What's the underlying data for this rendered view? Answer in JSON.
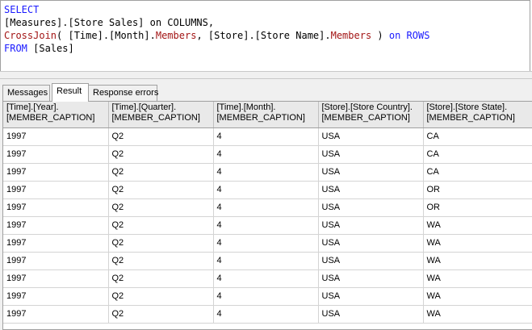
{
  "query": {
    "line1": "SELECT",
    "line2": "[Measures].[Store Sales] on COLUMNS,",
    "line3_fn": "CrossJoin",
    "line3_a": "( [Time].[Month].",
    "line3_members1": "Members",
    "line3_b": ", [Store].[Store Name].",
    "line3_members2": "Members",
    "line3_c": " ) ",
    "line3_kw": "on ROWS",
    "line4_kw": "FROM",
    "line4_rest": " [Sales]"
  },
  "tabs": [
    {
      "label": "Messages"
    },
    {
      "label": "Result"
    },
    {
      "label": "Response errors"
    }
  ],
  "grid": {
    "headers": [
      {
        "line1": "[Time].[Year].",
        "line2": "[MEMBER_CAPTION]"
      },
      {
        "line1": "[Time].[Quarter].",
        "line2": "[MEMBER_CAPTION]"
      },
      {
        "line1": "[Time].[Month].",
        "line2": "[MEMBER_CAPTION]"
      },
      {
        "line1": "[Store].[Store Country].",
        "line2": "[MEMBER_CAPTION]"
      },
      {
        "line1": "[Store].[Store State].",
        "line2": "[MEMBER_CAPTION]"
      }
    ],
    "rows": [
      [
        "1997",
        "Q2",
        "4",
        "USA",
        "CA"
      ],
      [
        "1997",
        "Q2",
        "4",
        "USA",
        "CA"
      ],
      [
        "1997",
        "Q2",
        "4",
        "USA",
        "CA"
      ],
      [
        "1997",
        "Q2",
        "4",
        "USA",
        "OR"
      ],
      [
        "1997",
        "Q2",
        "4",
        "USA",
        "OR"
      ],
      [
        "1997",
        "Q2",
        "4",
        "USA",
        "WA"
      ],
      [
        "1997",
        "Q2",
        "4",
        "USA",
        "WA"
      ],
      [
        "1997",
        "Q2",
        "4",
        "USA",
        "WA"
      ],
      [
        "1997",
        "Q2",
        "4",
        "USA",
        "WA"
      ],
      [
        "1997",
        "Q2",
        "4",
        "USA",
        "WA"
      ],
      [
        "1997",
        "Q2",
        "4",
        "USA",
        "WA"
      ]
    ]
  },
  "colors": {
    "keyword": "#1a1aff",
    "function": "#a31515"
  }
}
